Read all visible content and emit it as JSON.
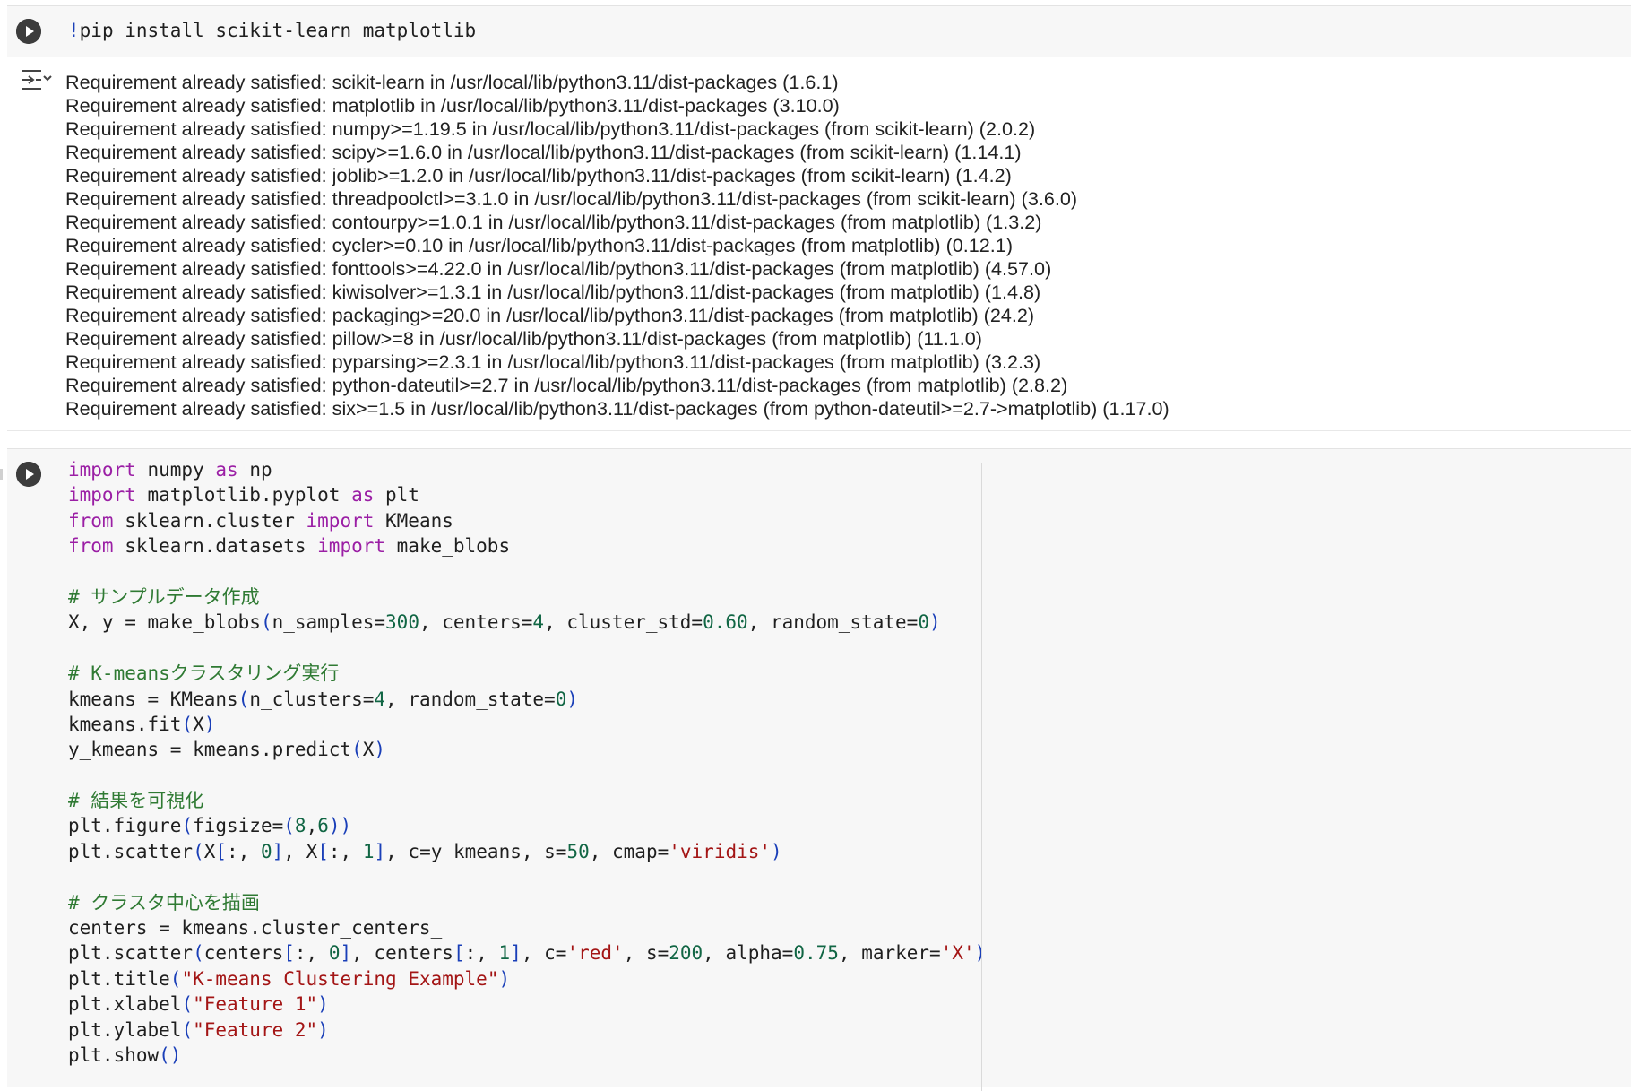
{
  "cell1": {
    "code": "pip install scikit-learn matplotlib",
    "code_bang": "!",
    "output_lines": [
      "Requirement already satisfied: scikit-learn in /usr/local/lib/python3.11/dist-packages (1.6.1)",
      "Requirement already satisfied: matplotlib in /usr/local/lib/python3.11/dist-packages (3.10.0)",
      "Requirement already satisfied: numpy>=1.19.5 in /usr/local/lib/python3.11/dist-packages (from scikit-learn) (2.0.2)",
      "Requirement already satisfied: scipy>=1.6.0 in /usr/local/lib/python3.11/dist-packages (from scikit-learn) (1.14.1)",
      "Requirement already satisfied: joblib>=1.2.0 in /usr/local/lib/python3.11/dist-packages (from scikit-learn) (1.4.2)",
      "Requirement already satisfied: threadpoolctl>=3.1.0 in /usr/local/lib/python3.11/dist-packages (from scikit-learn) (3.6.0)",
      "Requirement already satisfied: contourpy>=1.0.1 in /usr/local/lib/python3.11/dist-packages (from matplotlib) (1.3.2)",
      "Requirement already satisfied: cycler>=0.10 in /usr/local/lib/python3.11/dist-packages (from matplotlib) (0.12.1)",
      "Requirement already satisfied: fonttools>=4.22.0 in /usr/local/lib/python3.11/dist-packages (from matplotlib) (4.57.0)",
      "Requirement already satisfied: kiwisolver>=1.3.1 in /usr/local/lib/python3.11/dist-packages (from matplotlib) (1.4.8)",
      "Requirement already satisfied: packaging>=20.0 in /usr/local/lib/python3.11/dist-packages (from matplotlib) (24.2)",
      "Requirement already satisfied: pillow>=8 in /usr/local/lib/python3.11/dist-packages (from matplotlib) (11.1.0)",
      "Requirement already satisfied: pyparsing>=2.3.1 in /usr/local/lib/python3.11/dist-packages (from matplotlib) (3.2.3)",
      "Requirement already satisfied: python-dateutil>=2.7 in /usr/local/lib/python3.11/dist-packages (from matplotlib) (2.8.2)",
      "Requirement already satisfied: six>=1.5 in /usr/local/lib/python3.11/dist-packages (from python-dateutil>=2.7->matplotlib) (1.17.0)"
    ]
  },
  "cell2": {
    "lines": [
      [
        [
          "kw",
          "import"
        ],
        [
          "t",
          " numpy "
        ],
        [
          "kw",
          "as"
        ],
        [
          "t",
          " np"
        ]
      ],
      [
        [
          "kw",
          "import"
        ],
        [
          "t",
          " matplotlib.pyplot "
        ],
        [
          "kw",
          "as"
        ],
        [
          "t",
          " plt"
        ]
      ],
      [
        [
          "kw",
          "from"
        ],
        [
          "t",
          " sklearn.cluster "
        ],
        [
          "kw",
          "import"
        ],
        [
          "t",
          " KMeans"
        ]
      ],
      [
        [
          "kw",
          "from"
        ],
        [
          "t",
          " sklearn.datasets "
        ],
        [
          "kw",
          "import"
        ],
        [
          "t",
          " make_blobs"
        ]
      ],
      [],
      [
        [
          "cm",
          "# サンプルデータ作成"
        ]
      ],
      [
        [
          "t",
          "X, y = make_blobs"
        ],
        [
          "par",
          "("
        ],
        [
          "t",
          "n_samples="
        ],
        [
          "num",
          "300"
        ],
        [
          "t",
          ", centers="
        ],
        [
          "num",
          "4"
        ],
        [
          "t",
          ", cluster_std="
        ],
        [
          "num",
          "0.60"
        ],
        [
          "t",
          ", random_state="
        ],
        [
          "num",
          "0"
        ],
        [
          "par",
          ")"
        ]
      ],
      [],
      [
        [
          "cm",
          "# K-meansクラスタリング実行"
        ]
      ],
      [
        [
          "t",
          "kmeans = KMeans"
        ],
        [
          "par",
          "("
        ],
        [
          "t",
          "n_clusters="
        ],
        [
          "num",
          "4"
        ],
        [
          "t",
          ", random_state="
        ],
        [
          "num",
          "0"
        ],
        [
          "par",
          ")"
        ]
      ],
      [
        [
          "t",
          "kmeans.fit"
        ],
        [
          "par",
          "("
        ],
        [
          "t",
          "X"
        ],
        [
          "par",
          ")"
        ]
      ],
      [
        [
          "t",
          "y_kmeans = kmeans.predict"
        ],
        [
          "par",
          "("
        ],
        [
          "t",
          "X"
        ],
        [
          "par",
          ")"
        ]
      ],
      [],
      [
        [
          "cm",
          "# 結果を可視化"
        ]
      ],
      [
        [
          "t",
          "plt.figure"
        ],
        [
          "par",
          "("
        ],
        [
          "t",
          "figsize="
        ],
        [
          "par",
          "("
        ],
        [
          "num",
          "8"
        ],
        [
          "t",
          ","
        ],
        [
          "num",
          "6"
        ],
        [
          "par",
          "))"
        ]
      ],
      [
        [
          "t",
          "plt.scatter"
        ],
        [
          "par",
          "("
        ],
        [
          "t",
          "X"
        ],
        [
          "par",
          "["
        ],
        [
          "t",
          ":, "
        ],
        [
          "num",
          "0"
        ],
        [
          "par",
          "]"
        ],
        [
          "t",
          ", X"
        ],
        [
          "par",
          "["
        ],
        [
          "t",
          ":, "
        ],
        [
          "num",
          "1"
        ],
        [
          "par",
          "]"
        ],
        [
          "t",
          ", c=y_kmeans, s="
        ],
        [
          "num",
          "50"
        ],
        [
          "t",
          ", cmap="
        ],
        [
          "str",
          "'viridis'"
        ],
        [
          "par",
          ")"
        ]
      ],
      [],
      [
        [
          "cm",
          "# クラスタ中心を描画"
        ]
      ],
      [
        [
          "t",
          "centers = kmeans.cluster_centers_"
        ]
      ],
      [
        [
          "t",
          "plt.scatter"
        ],
        [
          "par",
          "("
        ],
        [
          "t",
          "centers"
        ],
        [
          "par",
          "["
        ],
        [
          "t",
          ":, "
        ],
        [
          "num",
          "0"
        ],
        [
          "par",
          "]"
        ],
        [
          "t",
          ", centers"
        ],
        [
          "par",
          "["
        ],
        [
          "t",
          ":, "
        ],
        [
          "num",
          "1"
        ],
        [
          "par",
          "]"
        ],
        [
          "t",
          ", c="
        ],
        [
          "str",
          "'red'"
        ],
        [
          "t",
          ", s="
        ],
        [
          "num",
          "200"
        ],
        [
          "t",
          ", alpha="
        ],
        [
          "num",
          "0.75"
        ],
        [
          "t",
          ", marker="
        ],
        [
          "str",
          "'X'"
        ],
        [
          "par",
          ")"
        ]
      ],
      [
        [
          "t",
          "plt.title"
        ],
        [
          "par",
          "("
        ],
        [
          "str",
          "\"K-means Clustering Example\""
        ],
        [
          "par",
          ")"
        ]
      ],
      [
        [
          "t",
          "plt.xlabel"
        ],
        [
          "par",
          "("
        ],
        [
          "str",
          "\"Feature 1\""
        ],
        [
          "par",
          ")"
        ]
      ],
      [
        [
          "t",
          "plt.ylabel"
        ],
        [
          "par",
          "("
        ],
        [
          "str",
          "\"Feature 2\""
        ],
        [
          "par",
          ")"
        ]
      ],
      [
        [
          "t",
          "plt.show"
        ],
        [
          "par",
          "()"
        ]
      ]
    ]
  },
  "icons": {
    "run": "play-circle-icon",
    "output_toggle": "output-collapse-icon"
  },
  "colors": {
    "keyword": "#9b1fa5",
    "comment": "#2f7a33",
    "number": "#116644",
    "string": "#a31515",
    "bracket": "#1a3fb8",
    "cell_bg": "#f7f7f7"
  }
}
